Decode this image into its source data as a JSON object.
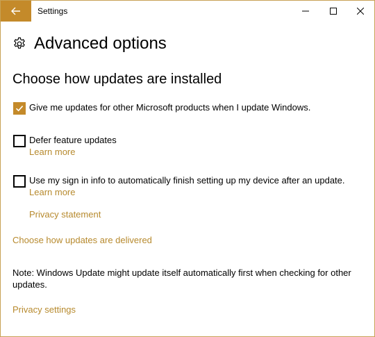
{
  "window": {
    "title": "Settings",
    "accent_color": "#c48a2a",
    "link_color": "#b78a2e"
  },
  "icons": {
    "back": "back-arrow-icon",
    "minimize": "minimize-icon",
    "maximize": "maximize-icon",
    "close": "close-icon",
    "page": "gear-icon"
  },
  "page": {
    "title": "Advanced options",
    "section_heading": "Choose how updates are installed"
  },
  "options": [
    {
      "label": "Give me updates for other Microsoft products when I update Windows.",
      "checked": true
    },
    {
      "label": "Defer feature updates",
      "checked": false,
      "link": "Learn more"
    },
    {
      "label": "Use my sign in info to automatically finish setting up my device after an update.",
      "checked": false,
      "link": "Learn more"
    }
  ],
  "links": {
    "privacy_statement": "Privacy statement",
    "delivery": "Choose how updates are delivered",
    "privacy_settings": "Privacy settings"
  },
  "note": "Note: Windows Update might update itself automatically first when checking for other updates."
}
